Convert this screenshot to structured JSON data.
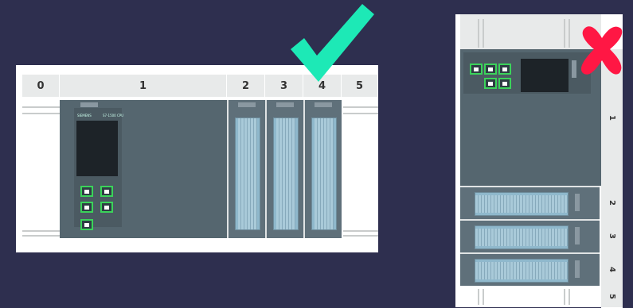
{
  "horizontal_rack": {
    "slots": [
      "0",
      "1",
      "2",
      "3",
      "4",
      "5"
    ],
    "cpu_brand": "SIEMENS",
    "cpu_model": "S7-1500 CPU"
  },
  "vertical_rack": {
    "slots": [
      "1",
      "2",
      "3",
      "4",
      "5"
    ]
  },
  "marks": {
    "correct_icon": "checkmark-icon",
    "wrong_icon": "cross-icon",
    "correct_color": "#1de9b6",
    "wrong_color": "#ff1744"
  }
}
